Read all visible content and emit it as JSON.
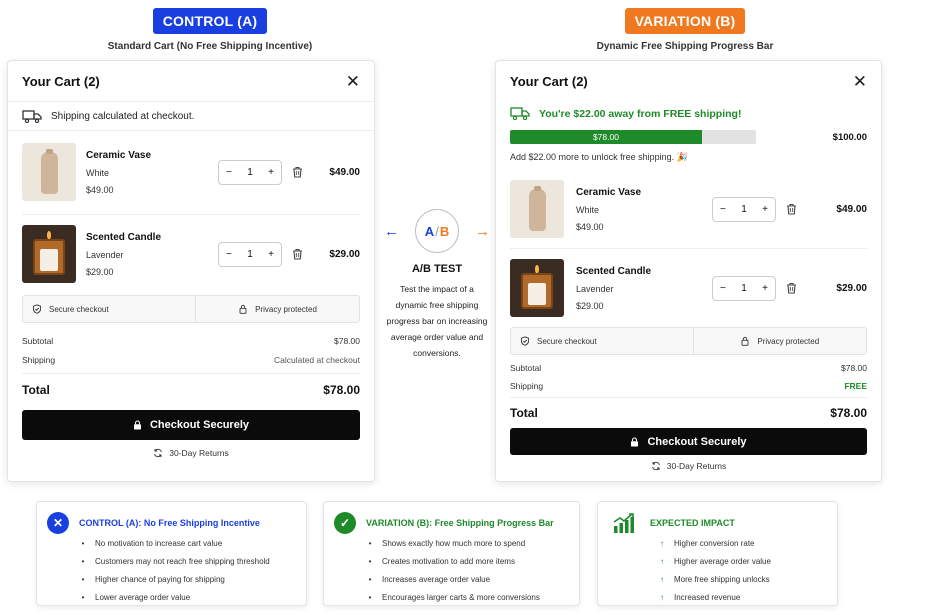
{
  "control_header": {
    "badge": "CONTROL (A)",
    "subtitle": "Standard Cart (No Free Shipping Incentive)",
    "color": "#1a3fe0"
  },
  "variation_header": {
    "badge": "VARIATION (B)",
    "subtitle": "Dynamic Free Shipping Progress Bar",
    "color": "#f0781e"
  },
  "control_cart": {
    "title": "Your Cart (2)",
    "shipping_note": "Shipping calculated at checkout.",
    "items": [
      {
        "name": "Ceramic Vase",
        "variant": "White",
        "unit_price": "$49.00",
        "qty": "1",
        "line_price": "$49.00",
        "image": "vase"
      },
      {
        "name": "Scented Candle",
        "variant": "Lavender",
        "unit_price": "$29.00",
        "qty": "1",
        "line_price": "$29.00",
        "image": "candle"
      }
    ],
    "trust": [
      "Secure checkout",
      "Privacy protected"
    ],
    "subtotal_label": "Subtotal",
    "subtotal": "$78.00",
    "shipping_label": "Shipping",
    "shipping": "Calculated at checkout",
    "total_label": "Total",
    "total": "$78.00",
    "checkout_label": "Checkout Securely",
    "returns": "30-Day Returns"
  },
  "variation_cart": {
    "title": "Your Cart (2)",
    "free_ship_message": "You're $22.00 away from FREE shipping!",
    "progress": {
      "current": "$78.00",
      "target": "$100.00",
      "fraction": 0.78
    },
    "unlock_note": "Add $22.00 more to unlock free shipping. 🎉",
    "items": [
      {
        "name": "Ceramic Vase",
        "variant": "White",
        "unit_price": "$49.00",
        "qty": "1",
        "line_price": "$49.00",
        "image": "vase"
      },
      {
        "name": "Scented Candle",
        "variant": "Lavender",
        "unit_price": "$29.00",
        "qty": "1",
        "line_price": "$29.00",
        "image": "candle"
      }
    ],
    "trust": [
      "Secure checkout",
      "Privacy protected"
    ],
    "subtotal_label": "Subtotal",
    "subtotal": "$78.00",
    "shipping_label": "Shipping",
    "shipping": "FREE",
    "total_label": "Total",
    "total": "$78.00",
    "checkout_label": "Checkout Securely",
    "returns": "30-Day Returns"
  },
  "ab_test": {
    "a": "A",
    "b": "B",
    "slash": "/",
    "title": "A/B TEST",
    "description": "Test the impact of a dynamic free shipping progress bar on increasing average order value and conversions."
  },
  "cards": {
    "control": {
      "title": "CONTROL (A): No Free Shipping Incentive",
      "icon": "x-icon",
      "color": "#1a3fe0",
      "points": [
        "No motivation to increase cart value",
        "Customers may not reach free shipping threshold",
        "Higher chance of paying for shipping",
        "Lower average order value"
      ]
    },
    "variation": {
      "title": "VARIATION (B): Free Shipping Progress Bar",
      "icon": "check-icon",
      "color": "#1f8a2a",
      "points": [
        "Shows exactly how much more to spend",
        "Creates motivation to add more items",
        "Increases average order value",
        "Encourages larger carts & more conversions"
      ]
    },
    "impact": {
      "title": "EXPECTED IMPACT",
      "icon": "growth-chart-icon",
      "color": "#1f8a2a",
      "points": [
        "Higher conversion rate",
        "Higher average order value",
        "More free shipping unlocks",
        "Increased revenue"
      ]
    }
  }
}
